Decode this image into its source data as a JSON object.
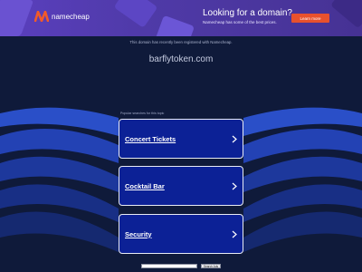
{
  "banner": {
    "logo_text": "namecheap",
    "promo_title": "Looking for a domain?",
    "promo_sub": "Namecheap has some of the best prices.",
    "cta_label": "Learn more",
    "accent": "#e8512d",
    "background": "#4f3aa8"
  },
  "page": {
    "notice": "This domain has recently been registered with Namecheap.",
    "domain": "barflytoken.com",
    "related_label": "Popular searches for this topic",
    "background": "#0f1a3a"
  },
  "links": [
    {
      "label": "Concert Tickets",
      "icon": "chevron-right-icon"
    },
    {
      "label": "Cocktail Bar",
      "icon": "chevron-right-icon"
    },
    {
      "label": "Security",
      "icon": "chevron-right-icon"
    }
  ],
  "search": {
    "placeholder": "",
    "button_label": "Search Ads"
  }
}
